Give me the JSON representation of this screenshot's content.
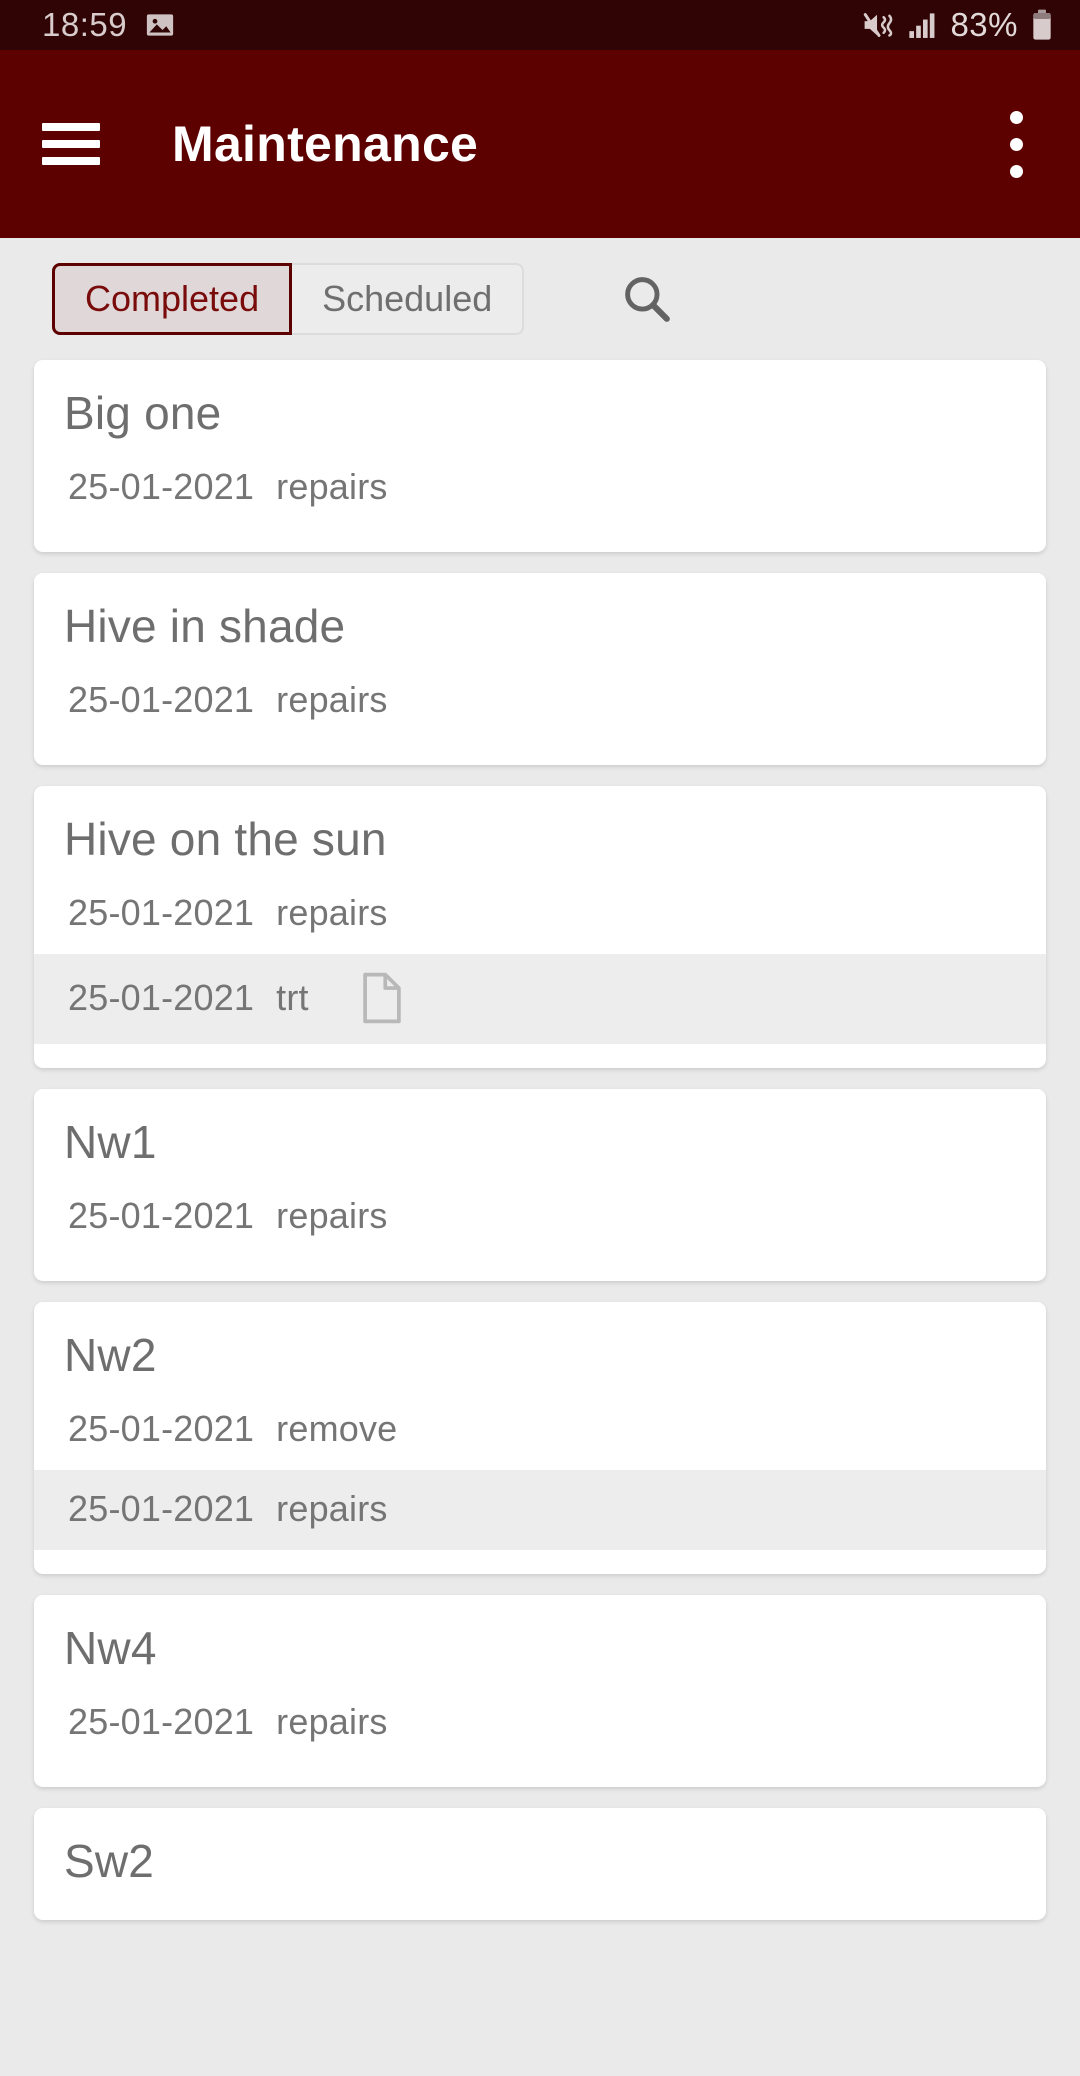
{
  "statusbar": {
    "time": "18:59",
    "photo_icon": "image-icon",
    "mute_icon": "volume-mute-vibrate-icon",
    "signal_icon": "cellular-signal-icon",
    "battery_text": "83%",
    "battery_icon": "battery-icon"
  },
  "appbar": {
    "menu_icon": "hamburger-menu-icon",
    "title": "Maintenance",
    "overflow_icon": "more-vertical-icon",
    "bg_color": "#5d0000"
  },
  "tabs": {
    "items": [
      {
        "label": "Completed",
        "selected": true
      },
      {
        "label": "Scheduled",
        "selected": false
      }
    ],
    "selected_color": "#7a0b0b",
    "search_icon": "search-icon"
  },
  "cards": [
    {
      "title": "Big one",
      "entries": [
        {
          "date": "25-01-2021",
          "type": "repairs",
          "shaded": false,
          "doc": false
        }
      ]
    },
    {
      "title": "Hive in shade",
      "entries": [
        {
          "date": "25-01-2021",
          "type": "repairs",
          "shaded": false,
          "doc": false
        }
      ]
    },
    {
      "title": "Hive on the sun",
      "entries": [
        {
          "date": "25-01-2021",
          "type": "repairs",
          "shaded": false,
          "doc": false
        },
        {
          "date": "25-01-2021",
          "type": "trt",
          "shaded": true,
          "doc": true
        }
      ]
    },
    {
      "title": "Nw1",
      "entries": [
        {
          "date": "25-01-2021",
          "type": "repairs",
          "shaded": false,
          "doc": false
        }
      ]
    },
    {
      "title": "Nw2",
      "entries": [
        {
          "date": "25-01-2021",
          "type": "remove",
          "shaded": false,
          "doc": false
        },
        {
          "date": "25-01-2021",
          "type": "repairs",
          "shaded": true,
          "doc": false
        }
      ]
    },
    {
      "title": "Nw4",
      "entries": [
        {
          "date": "25-01-2021",
          "type": "repairs",
          "shaded": false,
          "doc": false
        }
      ]
    },
    {
      "title": "Sw2",
      "entries": []
    }
  ]
}
